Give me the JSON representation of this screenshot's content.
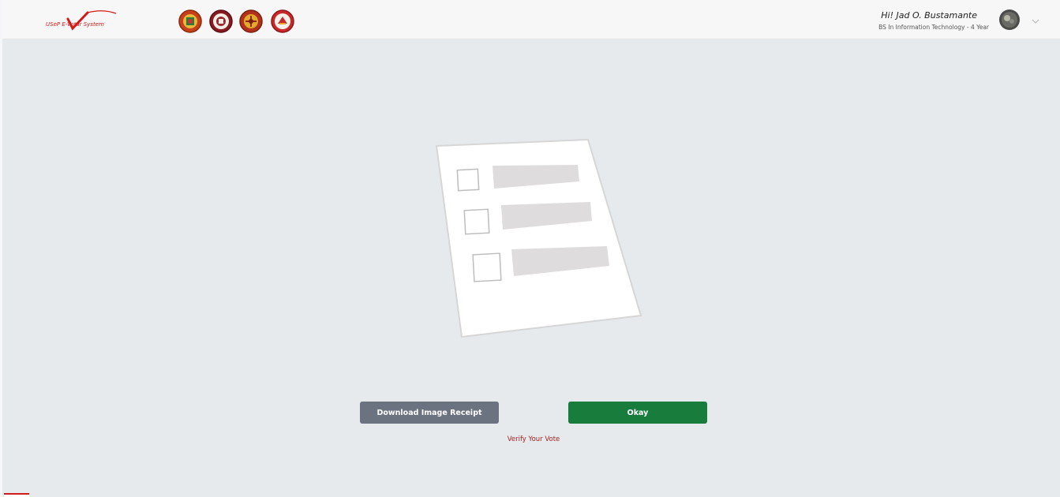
{
  "header": {
    "logo_text": "USeP E-Votar System",
    "seals": [
      "college-seal-1",
      "college-seal-2",
      "college-seal-3",
      "college-seal-4"
    ],
    "user_greeting": "Hi! Jad O. Bustamante",
    "user_program": "BS In Information Technology - 4 Year"
  },
  "main": {
    "download_label": "Download Image Receipt",
    "okay_label": "Okay",
    "verify_label": "Verify Your Vote"
  },
  "colors": {
    "brand_red": "#d11a1a",
    "okay_green": "#187c3d",
    "download_gray": "#6b7280",
    "background": "#e7eaed"
  }
}
